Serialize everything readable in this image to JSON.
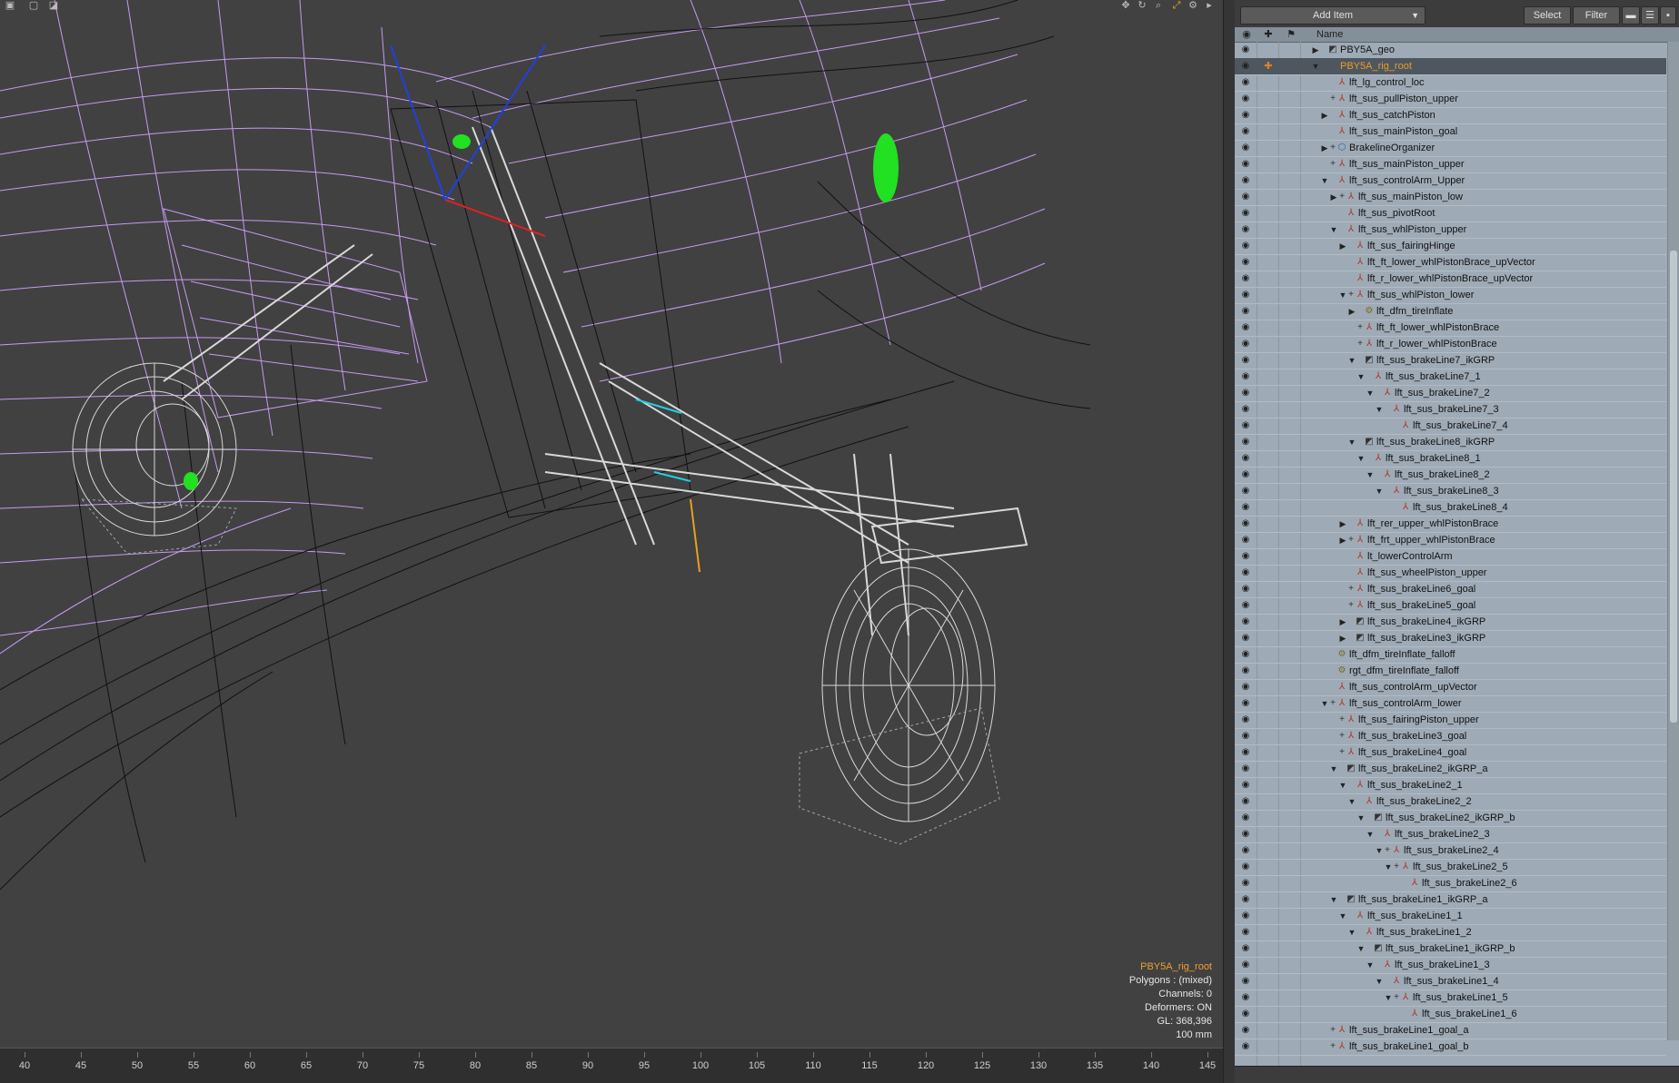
{
  "toolbar": {
    "add_item_label": "Add Item",
    "select_label": "Select",
    "filter_label": "Filter"
  },
  "columns": {
    "name_header": "Name"
  },
  "viewport": {
    "info": {
      "selected_name": "PBY5A_rig_root",
      "polygons": "Polygons : (mixed)",
      "channels": "Channels: 0",
      "deformers": "Deformers: ON",
      "gl": "GL: 368,396",
      "scale": "100 mm"
    },
    "ruler_labels": [
      "40",
      "45",
      "50",
      "55",
      "60",
      "65",
      "70",
      "75",
      "80",
      "85",
      "90",
      "95",
      "100",
      "105",
      "110",
      "115",
      "120",
      "125",
      "130",
      "135",
      "140",
      "145"
    ]
  },
  "colors": {
    "selected_text": "#f09a20",
    "panel_bg": "#9eaab5",
    "wire_purple": "#c79af0",
    "wire_gray": "#d8d8d8"
  },
  "items": [
    {
      "label": "PBY5A_geo",
      "depth": 0,
      "arrow": "right",
      "plus": false,
      "icon": "grp"
    },
    {
      "label": "PBY5A_rig_root",
      "depth": 0,
      "arrow": "down",
      "plus": false,
      "icon": "loc",
      "selected": true
    },
    {
      "label": "lft_lg_control_loc",
      "depth": 1,
      "arrow": "",
      "plus": false,
      "icon": "joint"
    },
    {
      "label": "lft_sus_pullPiston_upper",
      "depth": 1,
      "arrow": "",
      "plus": true,
      "icon": "joint"
    },
    {
      "label": "lft_sus_catchPiston",
      "depth": 1,
      "arrow": "right",
      "plus": false,
      "icon": "joint"
    },
    {
      "label": "lft_sus_mainPiston_goal",
      "depth": 1,
      "arrow": "",
      "plus": false,
      "icon": "joint"
    },
    {
      "label": "BrakelineOrganizer",
      "depth": 1,
      "arrow": "right",
      "plus": true,
      "icon": "org"
    },
    {
      "label": "lft_sus_mainPiston_upper",
      "depth": 1,
      "arrow": "",
      "plus": true,
      "icon": "joint"
    },
    {
      "label": "lft_sus_controlArm_Upper",
      "depth": 1,
      "arrow": "down",
      "plus": false,
      "icon": "joint"
    },
    {
      "label": "lft_sus_mainPiston_low",
      "depth": 2,
      "arrow": "right",
      "plus": true,
      "icon": "joint"
    },
    {
      "label": "lft_sus_pivotRoot",
      "depth": 2,
      "arrow": "",
      "plus": false,
      "icon": "joint"
    },
    {
      "label": "lft_sus_whlPiston_upper",
      "depth": 2,
      "arrow": "down",
      "plus": false,
      "icon": "joint"
    },
    {
      "label": "lft_sus_fairingHinge",
      "depth": 3,
      "arrow": "right",
      "plus": false,
      "icon": "joint"
    },
    {
      "label": "lft_ft_lower_whlPistonBrace_upVector",
      "depth": 3,
      "arrow": "",
      "plus": false,
      "icon": "joint"
    },
    {
      "label": "lft_r_lower_whlPistonBrace_upVector",
      "depth": 3,
      "arrow": "",
      "plus": false,
      "icon": "joint"
    },
    {
      "label": "lft_sus_whlPiston_lower",
      "depth": 3,
      "arrow": "down",
      "plus": true,
      "icon": "joint"
    },
    {
      "label": "lft_dfm_tireInflate",
      "depth": 4,
      "arrow": "right",
      "plus": false,
      "icon": "def"
    },
    {
      "label": "lft_ft_lower_whlPistonBrace",
      "depth": 4,
      "arrow": "",
      "plus": true,
      "icon": "joint"
    },
    {
      "label": "lft_r_lower_whlPistonBrace",
      "depth": 4,
      "arrow": "",
      "plus": true,
      "icon": "joint"
    },
    {
      "label": "lft_sus_brakeLine7_ikGRP",
      "depth": 4,
      "arrow": "down",
      "plus": false,
      "icon": "grp"
    },
    {
      "label": "lft_sus_brakeLine7_1",
      "depth": 5,
      "arrow": "down",
      "plus": false,
      "icon": "joint"
    },
    {
      "label": "lft_sus_brakeLine7_2",
      "depth": 6,
      "arrow": "down",
      "plus": false,
      "icon": "joint"
    },
    {
      "label": "lft_sus_brakeLine7_3",
      "depth": 7,
      "arrow": "down",
      "plus": false,
      "icon": "joint"
    },
    {
      "label": "lft_sus_brakeLine7_4",
      "depth": 8,
      "arrow": "",
      "plus": false,
      "icon": "joint"
    },
    {
      "label": "lft_sus_brakeLine8_ikGRP",
      "depth": 4,
      "arrow": "down",
      "plus": false,
      "icon": "grp"
    },
    {
      "label": "lft_sus_brakeLine8_1",
      "depth": 5,
      "arrow": "down",
      "plus": false,
      "icon": "joint"
    },
    {
      "label": "lft_sus_brakeLine8_2",
      "depth": 6,
      "arrow": "down",
      "plus": false,
      "icon": "joint"
    },
    {
      "label": "lft_sus_brakeLine8_3",
      "depth": 7,
      "arrow": "down",
      "plus": false,
      "icon": "joint"
    },
    {
      "label": "lft_sus_brakeLine8_4",
      "depth": 8,
      "arrow": "",
      "plus": false,
      "icon": "joint"
    },
    {
      "label": "lft_rer_upper_whlPistonBrace",
      "depth": 3,
      "arrow": "right",
      "plus": false,
      "icon": "joint"
    },
    {
      "label": "lft_frt_upper_whlPistonBrace",
      "depth": 3,
      "arrow": "right",
      "plus": true,
      "icon": "joint"
    },
    {
      "label": "lt_lowerControlArm",
      "depth": 3,
      "arrow": "",
      "plus": false,
      "icon": "joint"
    },
    {
      "label": "lft_sus_wheelPiston_upper",
      "depth": 3,
      "arrow": "",
      "plus": false,
      "icon": "joint"
    },
    {
      "label": "lft_sus_brakeLine6_goal",
      "depth": 3,
      "arrow": "",
      "plus": true,
      "icon": "joint"
    },
    {
      "label": "lft_sus_brakeLine5_goal",
      "depth": 3,
      "arrow": "",
      "plus": true,
      "icon": "joint"
    },
    {
      "label": "lft_sus_brakeLine4_ikGRP",
      "depth": 3,
      "arrow": "right",
      "plus": false,
      "icon": "grp"
    },
    {
      "label": "lft_sus_brakeLine3_ikGRP",
      "depth": 3,
      "arrow": "right",
      "plus": false,
      "icon": "grp"
    },
    {
      "label": "lft_dfm_tireInflate_falloff",
      "depth": 1,
      "arrow": "",
      "plus": false,
      "icon": "def"
    },
    {
      "label": "rgt_dfm_tireInflate_falloff",
      "depth": 1,
      "arrow": "",
      "plus": false,
      "icon": "def"
    },
    {
      "label": "lft_sus_controlArm_upVector",
      "depth": 1,
      "arrow": "",
      "plus": false,
      "icon": "joint"
    },
    {
      "label": "lft_sus_controlArm_lower",
      "depth": 1,
      "arrow": "down",
      "plus": true,
      "icon": "joint"
    },
    {
      "label": "lft_sus_fairingPiston_upper",
      "depth": 2,
      "arrow": "",
      "plus": true,
      "icon": "joint"
    },
    {
      "label": "lft_sus_brakeLine3_goal",
      "depth": 2,
      "arrow": "",
      "plus": true,
      "icon": "joint"
    },
    {
      "label": "lft_sus_brakeLine4_goal",
      "depth": 2,
      "arrow": "",
      "plus": true,
      "icon": "joint"
    },
    {
      "label": "lft_sus_brakeLine2_ikGRP_a",
      "depth": 2,
      "arrow": "down",
      "plus": false,
      "icon": "grp"
    },
    {
      "label": "lft_sus_brakeLine2_1",
      "depth": 3,
      "arrow": "down",
      "plus": false,
      "icon": "joint"
    },
    {
      "label": "lft_sus_brakeLine2_2",
      "depth": 4,
      "arrow": "down",
      "plus": false,
      "icon": "joint"
    },
    {
      "label": "lft_sus_brakeLine2_ikGRP_b",
      "depth": 5,
      "arrow": "down",
      "plus": false,
      "icon": "grp"
    },
    {
      "label": "lft_sus_brakeLine2_3",
      "depth": 6,
      "arrow": "down",
      "plus": false,
      "icon": "joint"
    },
    {
      "label": "lft_sus_brakeLine2_4",
      "depth": 7,
      "arrow": "down",
      "plus": true,
      "icon": "joint"
    },
    {
      "label": "lft_sus_brakeLine2_5",
      "depth": 8,
      "arrow": "down",
      "plus": true,
      "icon": "joint"
    },
    {
      "label": "lft_sus_brakeLine2_6",
      "depth": 9,
      "arrow": "",
      "plus": false,
      "icon": "joint"
    },
    {
      "label": "lft_sus_brakeLine1_ikGRP_a",
      "depth": 2,
      "arrow": "down",
      "plus": false,
      "icon": "grp"
    },
    {
      "label": "lft_sus_brakeLine1_1",
      "depth": 3,
      "arrow": "down",
      "plus": false,
      "icon": "joint"
    },
    {
      "label": "lft_sus_brakeLine1_2",
      "depth": 4,
      "arrow": "down",
      "plus": false,
      "icon": "joint"
    },
    {
      "label": "lft_sus_brakeLine1_ikGRP_b",
      "depth": 5,
      "arrow": "down",
      "plus": false,
      "icon": "grp"
    },
    {
      "label": "lft_sus_brakeLine1_3",
      "depth": 6,
      "arrow": "down",
      "plus": false,
      "icon": "joint"
    },
    {
      "label": "lft_sus_brakeLine1_4",
      "depth": 7,
      "arrow": "down",
      "plus": false,
      "icon": "joint"
    },
    {
      "label": "lft_sus_brakeLine1_5",
      "depth": 8,
      "arrow": "down",
      "plus": true,
      "icon": "joint"
    },
    {
      "label": "lft_sus_brakeLine1_6",
      "depth": 9,
      "arrow": "",
      "plus": false,
      "icon": "joint"
    },
    {
      "label": "lft_sus_brakeLine1_goal_a",
      "depth": 1,
      "arrow": "",
      "plus": true,
      "icon": "joint"
    },
    {
      "label": "lft_sus_brakeLine1_goal_b",
      "depth": 1,
      "arrow": "",
      "plus": true,
      "icon": "joint"
    }
  ]
}
